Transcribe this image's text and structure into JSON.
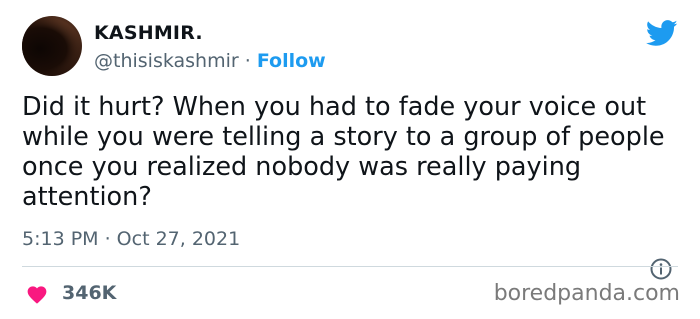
{
  "author": {
    "name": "KASHMIR.",
    "handle": "@thisiskashmir",
    "separator": "·",
    "follow_label": "Follow"
  },
  "tweet": {
    "text": "Did it hurt? When you had to fade your voice out while you were telling a story to a group of people once you realized nobody was really paying attention?",
    "timestamp": "5:13 PM · Oct 27, 2021",
    "likes": "346K"
  },
  "icons": {
    "brand": "twitter-bird-icon",
    "info": "info-icon",
    "like": "heart-icon"
  },
  "colors": {
    "accent": "#1d9bf0",
    "like": "#f91880",
    "secondary_text": "#536471"
  },
  "watermark": "boredpanda.com"
}
